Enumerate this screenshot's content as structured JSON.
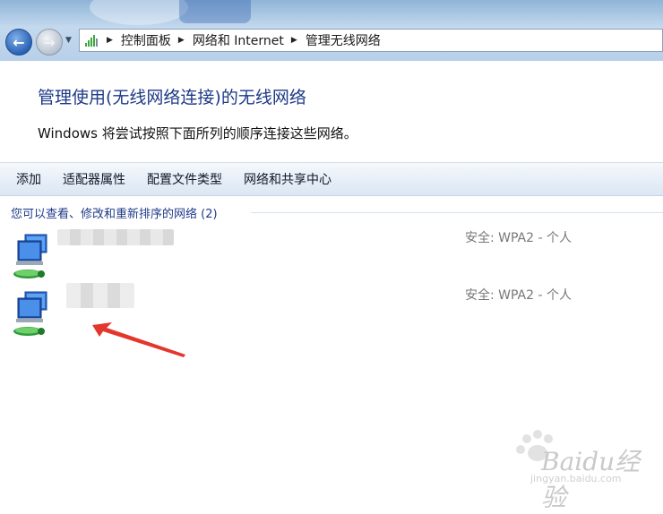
{
  "window": {
    "nav": {
      "back_icon": "arrow-left-icon",
      "forward_icon": "arrow-right-icon",
      "history_icon": "chevron-down-icon"
    },
    "breadcrumb": [
      "控制面板",
      "网络和 Internet",
      "管理无线网络"
    ]
  },
  "header": {
    "title": "管理使用(无线网络连接)的无线网络",
    "description": "Windows 将尝试按照下面所列的顺序连接这些网络。"
  },
  "toolbar": {
    "items": [
      "添加",
      "适配器属性",
      "配置文件类型",
      "网络和共享中心"
    ]
  },
  "list": {
    "group_header": "您可以查看、修改和重新排序的网络 (2)",
    "networks": [
      {
        "icon": "wireless-network-pc-icon",
        "security": "安全: WPA2 - 个人"
      },
      {
        "icon": "wireless-network-pc-icon",
        "security": "安全: WPA2 - 个人"
      }
    ]
  },
  "annotation": {
    "icon": "red-arrow-icon",
    "color": "#e3362c"
  },
  "watermark": {
    "text": "Baidu经验",
    "url": "jingyan.baidu.com"
  }
}
